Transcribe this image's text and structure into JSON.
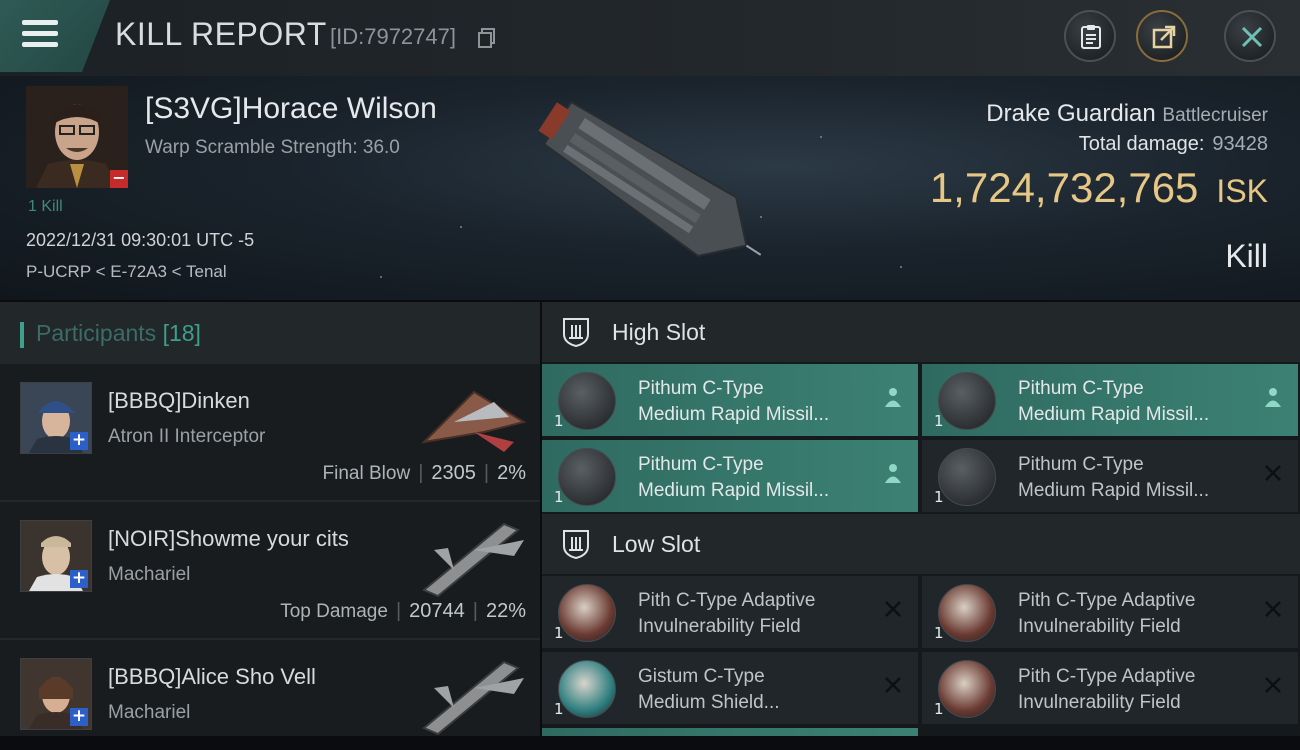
{
  "header": {
    "title": "KILL REPORT",
    "report_id": "[ID:7972747]",
    "buttons": [
      {
        "name": "clipboard-icon"
      },
      {
        "name": "share-icon"
      },
      {
        "name": "close-icon"
      }
    ]
  },
  "victim": {
    "name": "[S3VG]Horace Wilson",
    "warp_scramble": "Warp Scramble Strength: 36.0",
    "kill_count": "1 Kill",
    "timestamp": "2022/12/31 09:30:01 UTC -5",
    "location": "P-UCRP < E-72A3 < Tenal"
  },
  "ship": {
    "name": "Drake Guardian",
    "class": "Battlecruiser",
    "damage_label": "Total damage:",
    "damage_value": "93428",
    "isk_value": "1,724,732,765",
    "isk_unit": "ISK",
    "result": "Kill"
  },
  "participants": {
    "label": "Participants",
    "count": "[18]",
    "items": [
      {
        "name": "[BBBQ]Dinken",
        "ship": "Atron II Interceptor",
        "tag": "Final Blow",
        "damage": "2305",
        "percent": "2%"
      },
      {
        "name": "[NOIR]Showme your cits",
        "ship": "Machariel",
        "tag": "Top Damage",
        "damage": "20744",
        "percent": "22%"
      },
      {
        "name": "[BBBQ]Alice Sho Vell",
        "ship": "Machariel",
        "tag": "",
        "damage": "",
        "percent": ""
      }
    ]
  },
  "fitting": {
    "high_slot_label": "High Slot",
    "low_slot_label": "Low Slot",
    "high_slot": [
      {
        "line1": "Pithum C-Type",
        "line2": "Medium Rapid Missil...",
        "qty": "1",
        "status": "dropped",
        "active": true
      },
      {
        "line1": "Pithum C-Type",
        "line2": "Medium Rapid Missil...",
        "qty": "1",
        "status": "dropped",
        "active": true
      },
      {
        "line1": "Pithum C-Type",
        "line2": "Medium Rapid Missil...",
        "qty": "1",
        "status": "dropped",
        "active": true
      },
      {
        "line1": "Pithum C-Type",
        "line2": "Medium Rapid Missil...",
        "qty": "1",
        "status": "destroyed",
        "active": false
      }
    ],
    "low_slot": [
      {
        "line1": "Pith C-Type Adaptive",
        "line2": "Invulnerability Field",
        "qty": "1",
        "status": "destroyed",
        "active": false
      },
      {
        "line1": "Pith C-Type Adaptive",
        "line2": "Invulnerability Field",
        "qty": "1",
        "status": "destroyed",
        "active": false
      },
      {
        "line1": "Gistum C-Type",
        "line2": "Medium Shield...",
        "qty": "1",
        "status": "destroyed",
        "active": false
      },
      {
        "line1": "Pith C-Type Adaptive",
        "line2": "Invulnerability Field",
        "qty": "1",
        "status": "destroyed",
        "active": false
      }
    ]
  }
}
